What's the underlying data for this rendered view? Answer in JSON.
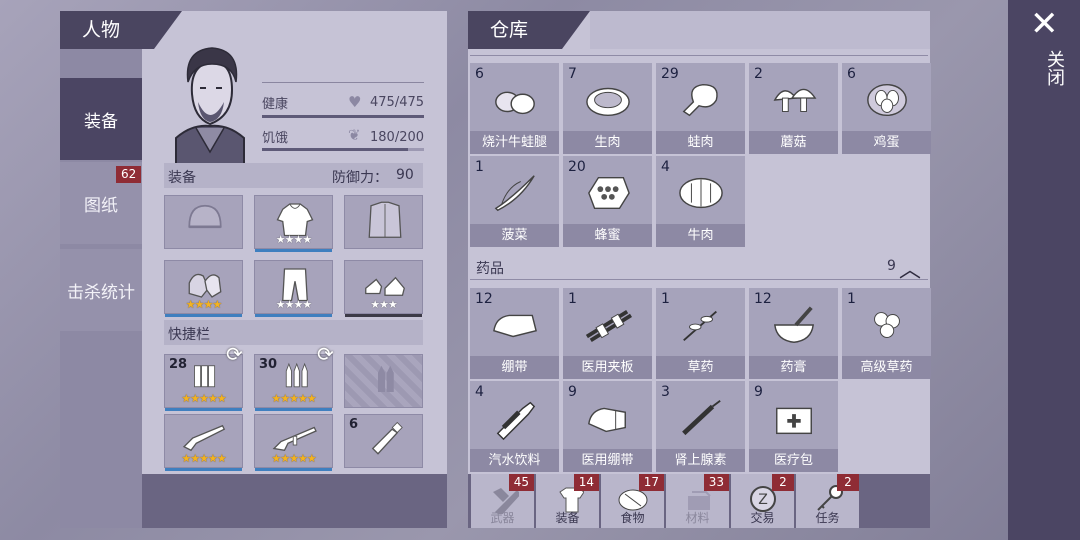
{
  "character": {
    "header": "人物",
    "health_label": "健康",
    "health_value": "475/475",
    "hunger_label": "饥饿",
    "hunger_value": "180/200",
    "equip_label": "装备",
    "defense_label": "防御力：",
    "defense_value": "90",
    "quickbar_label": "快捷栏"
  },
  "tabs": [
    {
      "label": "装备",
      "active": true
    },
    {
      "label": "图纸",
      "badge": "62"
    },
    {
      "label": "击杀统计"
    }
  ],
  "equipment": [
    {
      "icon": "beanie-icon",
      "stars_gold": 0,
      "stars_white": 0
    },
    {
      "icon": "hoodie-icon",
      "stars_gold": 0,
      "stars_white": 4
    },
    {
      "icon": "jacket-icon",
      "stars_gold": 0,
      "stars_white": 0
    },
    {
      "icon": "gloves-icon",
      "stars_gold": 4,
      "stars_white": 0
    },
    {
      "icon": "pants-icon",
      "stars_gold": 0,
      "stars_white": 4
    },
    {
      "icon": "sneakers-icon",
      "stars_gold": 0,
      "stars_white": 3
    }
  ],
  "quickbar": [
    {
      "icon": "shotgun-shells-icon",
      "count": "28",
      "stars_gold": 5
    },
    {
      "icon": "rifle-bullets-icon",
      "count": "30",
      "stars_gold": 5
    },
    {
      "icon": "empty-ammo-slot-icon",
      "count": "",
      "stars_gold": 0
    },
    {
      "icon": "shotgun-icon",
      "count": "",
      "stars_gold": 5
    },
    {
      "icon": "rifle-icon",
      "count": "",
      "stars_gold": 5
    },
    {
      "icon": "water-bottle-icon",
      "count": "6",
      "stars_gold": 0
    }
  ],
  "warehouse": {
    "header": "仓库",
    "close_label": "关闭",
    "food": [
      {
        "count": "6",
        "name": "烧汁牛蛙腿",
        "icon": "frog-legs-icon"
      },
      {
        "count": "7",
        "name": "生肉",
        "icon": "raw-meat-icon"
      },
      {
        "count": "29",
        "name": "蛙肉",
        "icon": "drumstick-icon"
      },
      {
        "count": "2",
        "name": "蘑菇",
        "icon": "mushroom-icon"
      },
      {
        "count": "6",
        "name": "鸡蛋",
        "icon": "eggs-icon"
      },
      {
        "count": "1",
        "name": "菠菜",
        "icon": "spinach-icon"
      },
      {
        "count": "20",
        "name": "蜂蜜",
        "icon": "honeycomb-icon"
      },
      {
        "count": "4",
        "name": "牛肉",
        "icon": "beef-icon"
      }
    ],
    "med_section": {
      "label": "药品",
      "count": "9"
    },
    "medicine": [
      {
        "count": "12",
        "name": "绷带",
        "icon": "bandage-icon"
      },
      {
        "count": "1",
        "name": "医用夹板",
        "icon": "splint-icon"
      },
      {
        "count": "1",
        "name": "草药",
        "icon": "herb-icon"
      },
      {
        "count": "12",
        "name": "药膏",
        "icon": "mortar-icon"
      },
      {
        "count": "1",
        "name": "高级草药",
        "icon": "premium-herb-icon"
      },
      {
        "count": "4",
        "name": "汽水饮料",
        "icon": "soda-icon"
      },
      {
        "count": "9",
        "name": "医用绷带",
        "icon": "medical-bandage-icon"
      },
      {
        "count": "3",
        "name": "肾上腺素",
        "icon": "syringe-icon"
      },
      {
        "count": "9",
        "name": "医疗包",
        "icon": "medkit-icon"
      }
    ],
    "bottom_tabs": [
      {
        "label": "武器",
        "badge": "45",
        "icon": "axe-icon",
        "dim": true
      },
      {
        "label": "装备",
        "badge": "14",
        "icon": "shirt-icon",
        "dim": false
      },
      {
        "label": "食物",
        "badge": "17",
        "icon": "meat-icon",
        "dim": false
      },
      {
        "label": "材料",
        "badge": "33",
        "icon": "materials-icon",
        "dim": true
      },
      {
        "label": "交易",
        "badge": "2",
        "icon": "coin-icon",
        "dim": false
      },
      {
        "label": "任务",
        "badge": "2",
        "icon": "key-icon",
        "dim": false
      }
    ]
  },
  "colors": {
    "dark_purple": "#4a4560",
    "star_gold": "#f4b320",
    "badge_red": "#8f2c35"
  }
}
